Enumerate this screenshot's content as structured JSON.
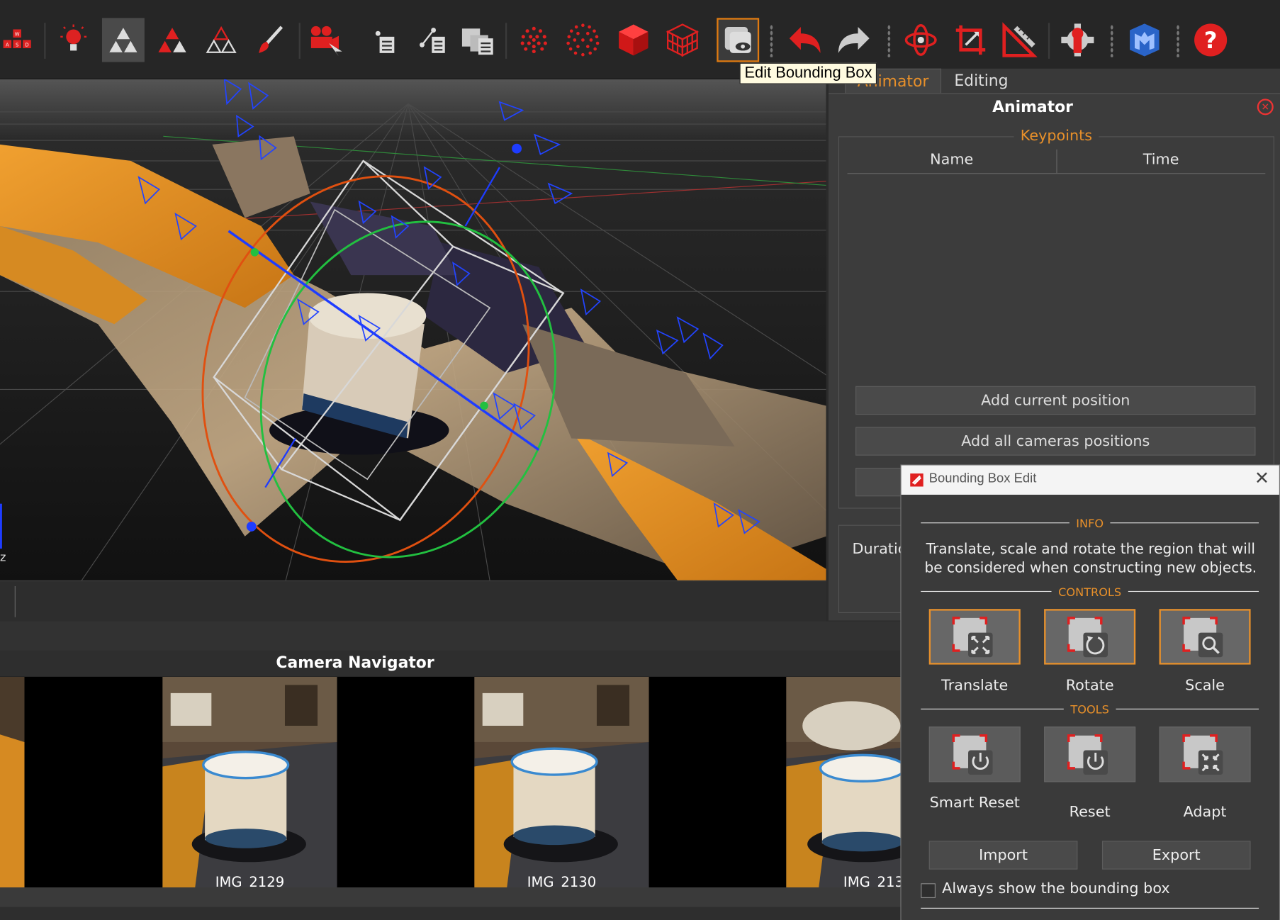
{
  "toolbar": {
    "tooltip": "Edit Bounding Box",
    "buttons": [
      {
        "name": "wasd-navigation"
      },
      {
        "name": "lightbulb"
      },
      {
        "name": "mesh-solid"
      },
      {
        "name": "mesh-shaded"
      },
      {
        "name": "mesh-wireframe"
      },
      {
        "name": "paint-brush"
      },
      {
        "name": "camera-tool"
      },
      {
        "name": "sparse-points"
      },
      {
        "name": "scene-node"
      },
      {
        "name": "layers"
      },
      {
        "name": "point-cloud-sparse"
      },
      {
        "name": "point-cloud-dense"
      },
      {
        "name": "solid-cube"
      },
      {
        "name": "wire-cube"
      },
      {
        "name": "edit-bounding-box"
      },
      {
        "name": "undo"
      },
      {
        "name": "redo"
      },
      {
        "name": "orbit"
      },
      {
        "name": "crop"
      },
      {
        "name": "ruler"
      },
      {
        "name": "settings"
      },
      {
        "name": "metashape-logo"
      },
      {
        "name": "help"
      }
    ]
  },
  "viewport": {
    "axis_label": "z"
  },
  "right_panel": {
    "tabs": [
      {
        "label": "Animator"
      },
      {
        "label": "Editing"
      }
    ],
    "title": "Animator",
    "keypoints_label": "Keypoints",
    "columns": [
      "Name",
      "Time"
    ],
    "buttons": {
      "add_current": "Add current position",
      "add_all": "Add all cameras positions"
    },
    "duration_label": "Duratic"
  },
  "camera_navigator": {
    "title": "Camera Navigator",
    "thumbnails": [
      {
        "label": "IMG_2129"
      },
      {
        "label": "IMG_2130"
      },
      {
        "label": "IMG_213"
      }
    ]
  },
  "bbox_dialog": {
    "title": "Bounding Box Edit",
    "info_label": "INFO",
    "info_text": "Translate, scale and rotate the region that will be considered when constructing new objects.",
    "controls_label": "CONTROLS",
    "controls": [
      {
        "label": "Translate"
      },
      {
        "label": "Rotate"
      },
      {
        "label": "Scale"
      }
    ],
    "tools_label": "TOOLS",
    "tools": [
      {
        "label": "Smart Reset"
      },
      {
        "label": "Reset"
      },
      {
        "label": "Adapt"
      }
    ],
    "import_label": "Import",
    "export_label": "Export",
    "always_show_label": "Always show the bounding box",
    "always_show_checked": false
  },
  "colors": {
    "accent_orange": "#e8902a",
    "icon_red": "#e02020",
    "gizmo_blue": "#1e3cff",
    "gizmo_green": "#22c040",
    "gizmo_red": "#e05010"
  }
}
